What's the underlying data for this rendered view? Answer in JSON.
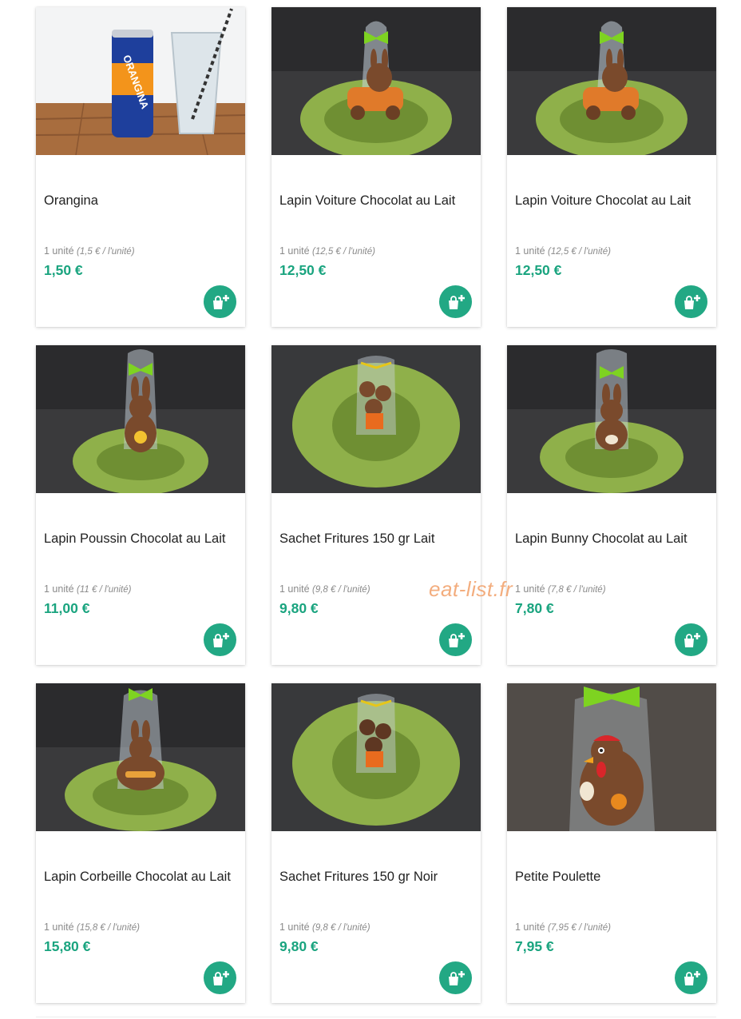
{
  "products": [
    {
      "name": "Orangina",
      "qty": "1 unité",
      "unit_price": "(1,5 € / l'unité)",
      "price": "1,50 €",
      "image": "orangina-can-photo"
    },
    {
      "name": "Lapin Voiture Chocolat au Lait",
      "qty": "1 unité",
      "unit_price": "(12,5 € / l'unité)",
      "price": "12,50 €",
      "image": "chocolate-rabbit-car-photo"
    },
    {
      "name": "Lapin Voiture Chocolat au Lait",
      "qty": "1 unité",
      "unit_price": "(12,5 € / l'unité)",
      "price": "12,50 €",
      "image": "chocolate-rabbit-car-photo"
    },
    {
      "name": "Lapin Poussin Chocolat au Lait",
      "qty": "1 unité",
      "unit_price": "(11 € / l'unité)",
      "price": "11,00 €",
      "image": "chocolate-rabbit-chick-photo"
    },
    {
      "name": "Sachet Fritures 150 gr Lait",
      "qty": "1 unité",
      "unit_price": "(9,8 € / l'unité)",
      "price": "9,80 €",
      "image": "chocolate-fritures-bag-photo"
    },
    {
      "name": "Lapin Bunny Chocolat au Lait",
      "qty": "1 unité",
      "unit_price": "(7,8 € / l'unité)",
      "price": "7,80 €",
      "image": "chocolate-bunny-photo"
    },
    {
      "name": "Lapin Corbeille Chocolat au Lait",
      "qty": "1 unité",
      "unit_price": "(15,8 € / l'unité)",
      "price": "15,80 €",
      "image": "chocolate-rabbit-basket-photo"
    },
    {
      "name": "Sachet Fritures 150 gr Noir",
      "qty": "1 unité",
      "unit_price": "(9,8 € / l'unité)",
      "price": "9,80 €",
      "image": "chocolate-fritures-bag-photo"
    },
    {
      "name": "Petite Poulette",
      "qty": "1 unité",
      "unit_price": "(7,95 € / l'unité)",
      "price": "7,95 €",
      "image": "chocolate-hen-photo"
    }
  ],
  "add_to_cart_icon": "shopping-bag-plus-icon",
  "watermark": "eat-list.fr",
  "colors": {
    "price": "#1aa47f",
    "button": "#22a884",
    "grass": "#8fb04a",
    "bow": "#7ed321",
    "chocolate": "#7a4a2c"
  }
}
